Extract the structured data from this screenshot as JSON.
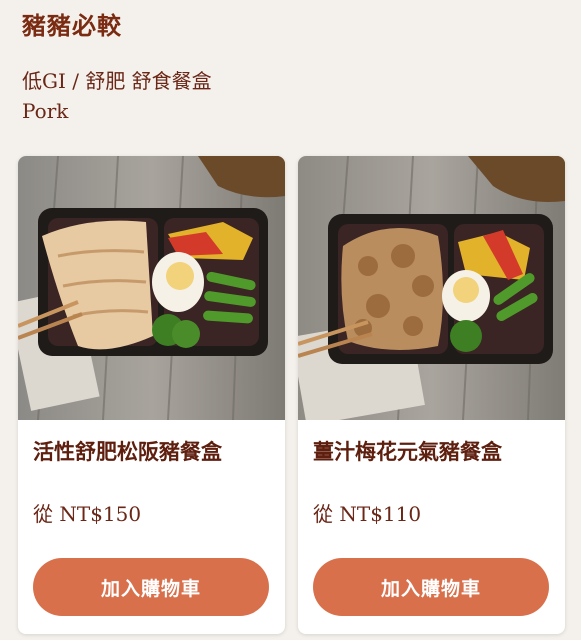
{
  "section": {
    "title": "豬豬必較"
  },
  "subtitle": {
    "line1": "低GI / 舒肥 舒食餐盒",
    "line2": "Pork"
  },
  "products": [
    {
      "name": "活性舒肥松阪豬餐盒",
      "price": "從 NT$150",
      "button": "加入購物車",
      "image": "pork-fillet-meal-box-photo"
    },
    {
      "name": "薑汁梅花元氣豬餐盒",
      "price": "從 NT$110",
      "button": "加入購物車",
      "image": "ginger-pork-meal-box-photo"
    }
  ],
  "colors": {
    "background": "#f4f1ec",
    "title": "#7a2b12",
    "button": "#d9704c",
    "button_text": "#ffffff"
  }
}
